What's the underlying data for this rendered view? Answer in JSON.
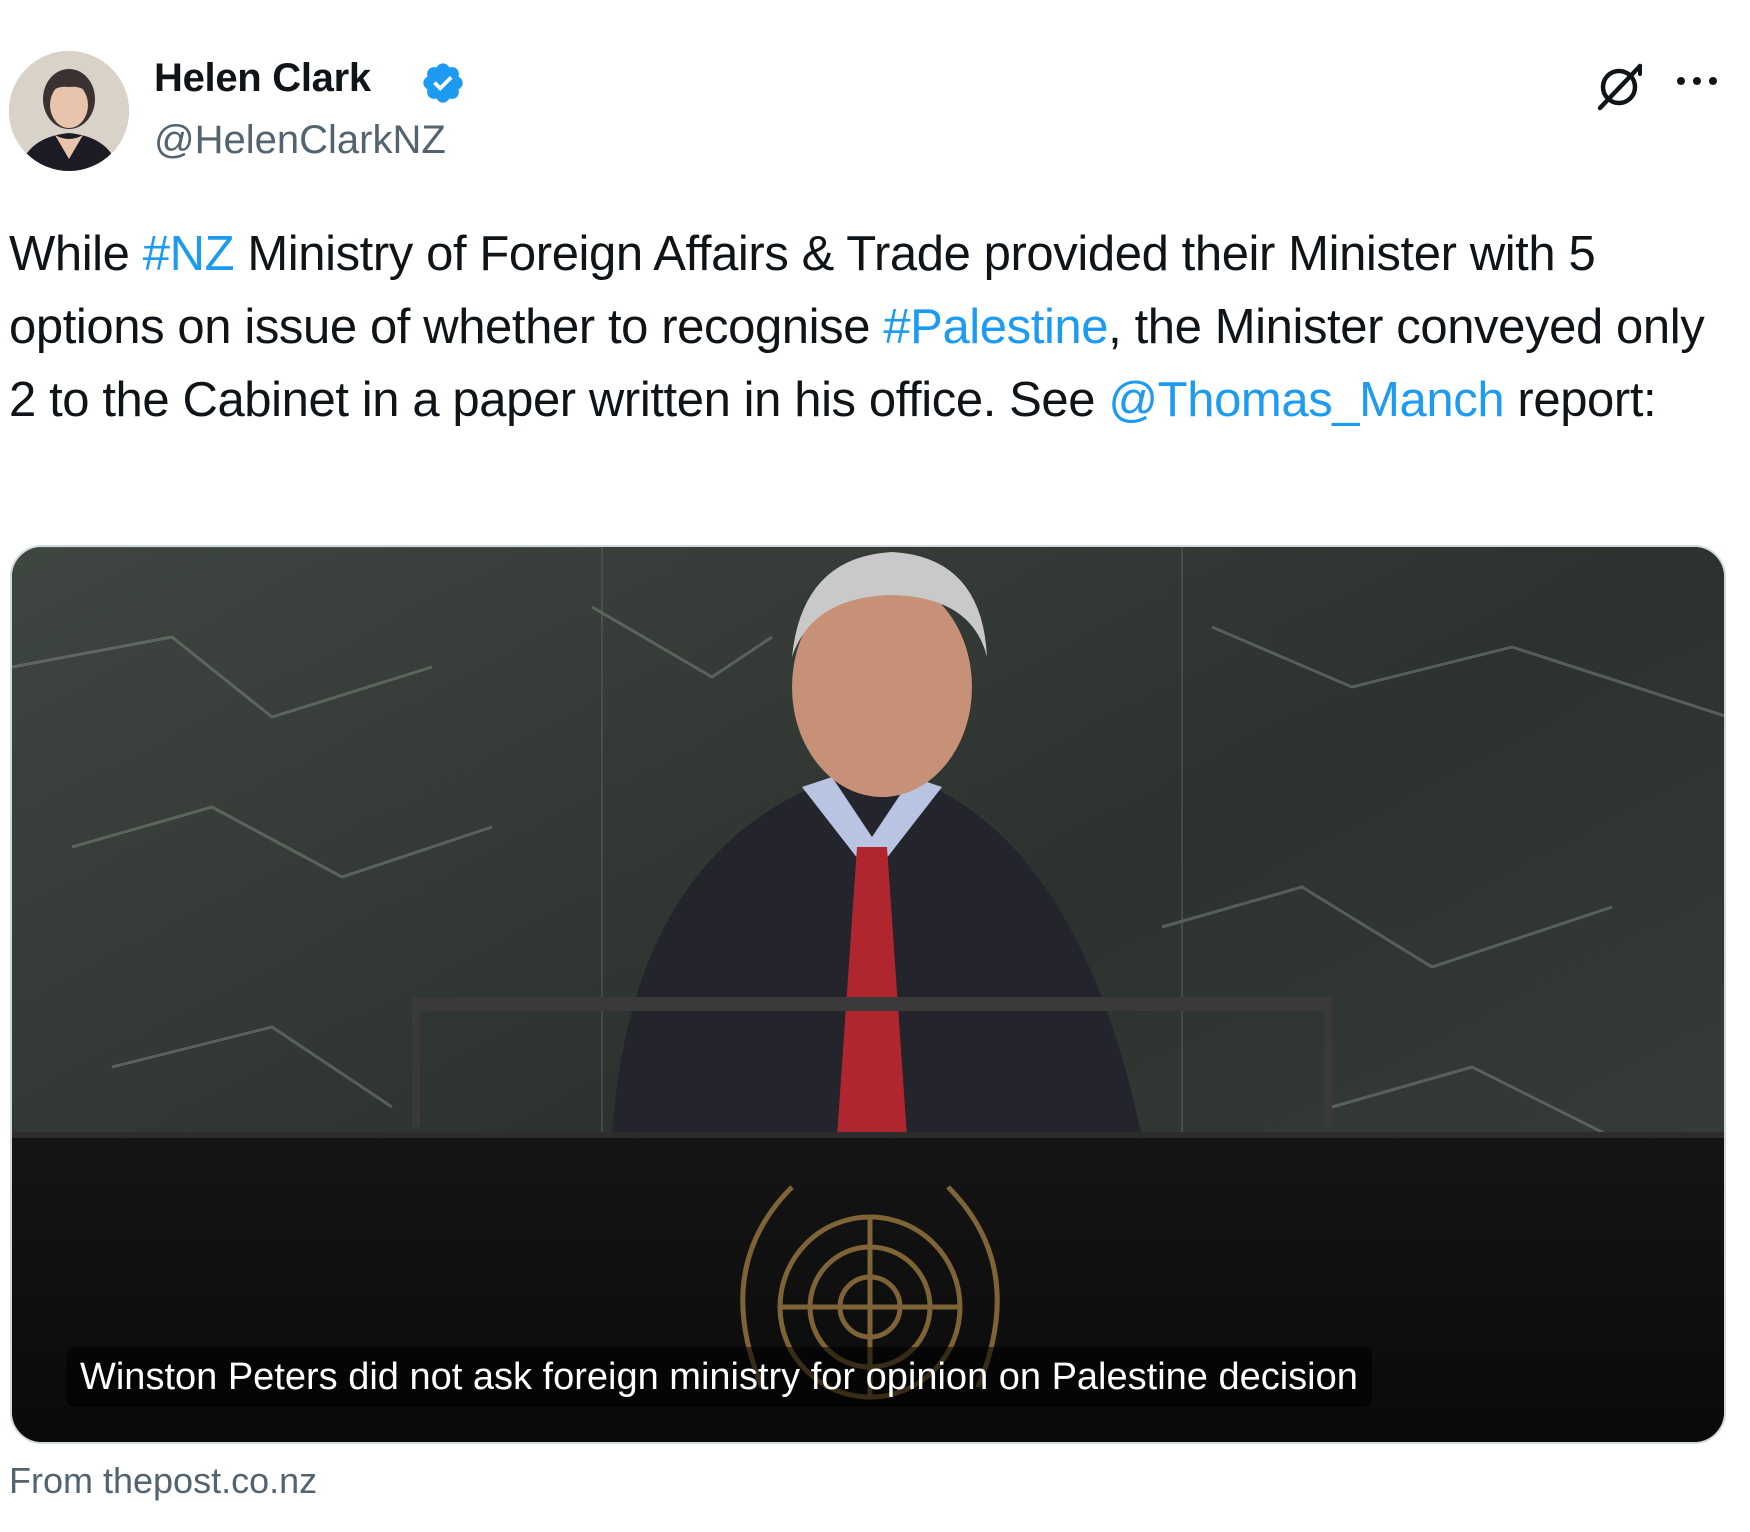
{
  "author": {
    "name": "Helen Clark",
    "handle": "@HelenClarkNZ",
    "verified_icon": "verified-badge-icon",
    "avatar": "profile-photo"
  },
  "header_actions": {
    "grok_icon": "grok-slash-icon",
    "more_icon": "more-dots-icon"
  },
  "tweet": {
    "segments": [
      {
        "text": "While ",
        "type": "text"
      },
      {
        "text": "#NZ",
        "type": "hashtag"
      },
      {
        "text": " Ministry of Foreign Affairs & Trade provided their Minister with 5 options on issue of whether to recognise ",
        "type": "text"
      },
      {
        "text": "#Palestine",
        "type": "hashtag"
      },
      {
        "text": ", the Minister conveyed only 2 to the Cabinet in a paper written in his office. See ",
        "type": "text"
      },
      {
        "text": "@Thomas_Manch",
        "type": "mention"
      },
      {
        "text": " report:",
        "type": "text"
      }
    ]
  },
  "link_card": {
    "image_alt": "Winston Peters speaking at UN podium",
    "caption": "Winston Peters did not ask foreign ministry for opinion on Palestine decision",
    "source": "From thepost.co.nz"
  },
  "colors": {
    "link": "#1d9bf0",
    "text": "#0f1419",
    "secondary": "#536471",
    "verified": "#1d9bf0"
  }
}
